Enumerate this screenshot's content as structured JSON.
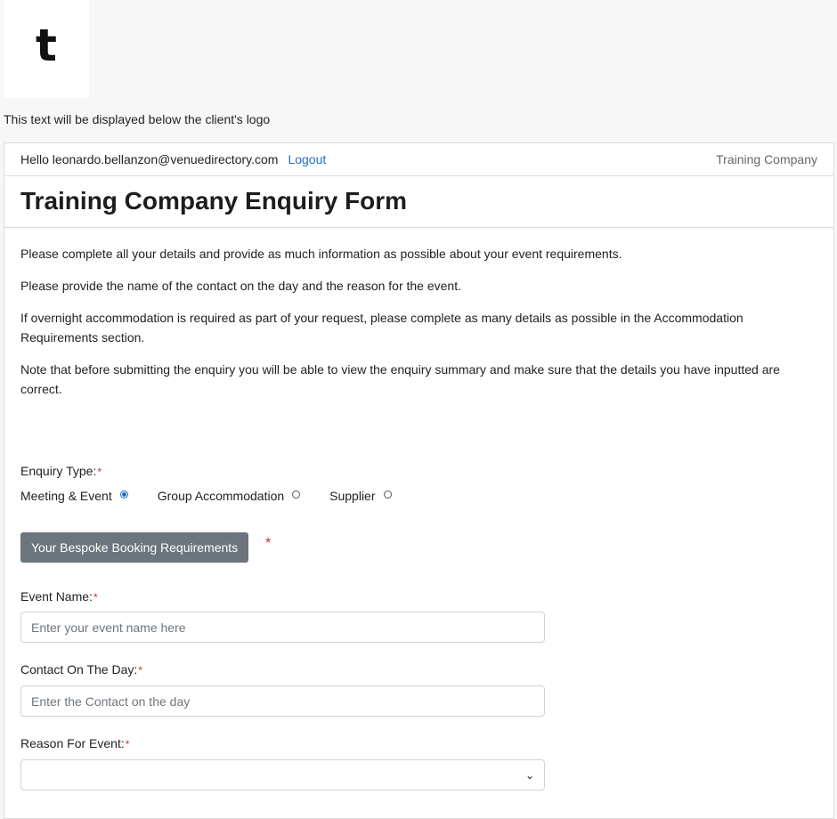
{
  "logo": {
    "glyph": "t"
  },
  "below_logo_text": "This text will be displayed below the client's logo",
  "userbar": {
    "hello": "Hello leonardo.bellanzon@venuedirectory.com",
    "logout": "Logout",
    "company": "Training Company"
  },
  "form": {
    "title": "Training Company Enquiry Form",
    "intro": [
      "Please complete all your details and provide as much information as possible about your event requirements.",
      "Please provide the name of the contact on the day and the reason for the event.",
      "If overnight accommodation is required as part of your request, please complete as many details as possible in the Accommodation Requirements section.",
      "Note that before submitting the enquiry you will be able to view the enquiry summary and make sure that the details you have inputted are correct."
    ],
    "enquiry_type_label": "Enquiry Type:",
    "enquiry_types": [
      {
        "label": "Meeting & Event",
        "checked": true
      },
      {
        "label": "Group Accommodation",
        "checked": false
      },
      {
        "label": "Supplier",
        "checked": false
      }
    ],
    "bespoke_button": "Your Bespoke Booking Requirements",
    "event_name_label": "Event Name:",
    "event_name_placeholder": "Enter your event name here",
    "contact_label": "Contact On The Day:",
    "contact_placeholder": "Enter the Contact on the day",
    "reason_label": "Reason For Event:",
    "reason_value": "",
    "required_mark": "*"
  },
  "colors": {
    "accent": "#1f6fd1",
    "required": "#dc2a2a",
    "button": "#6c757d"
  }
}
